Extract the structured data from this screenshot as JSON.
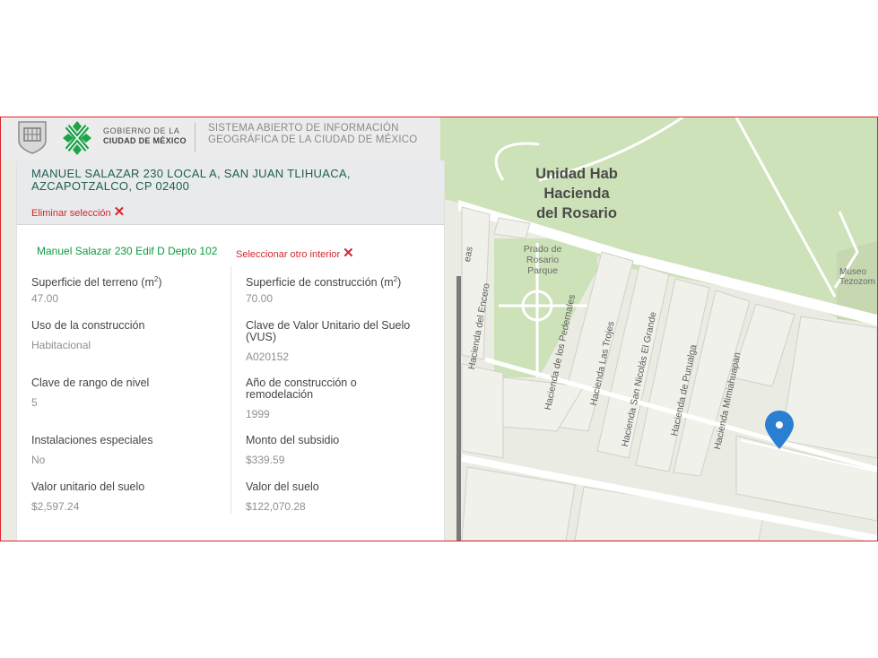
{
  "header": {
    "gov_line1": "GOBIERNO DE LA",
    "gov_line2": "CIUDAD DE MÉXICO",
    "system_line1": "SISTEMA ABIERTO DE INFORMACIÓN",
    "system_line2": "GEOGRÁFICA DE LA CIUDAD DE MÉXICO"
  },
  "selection": {
    "address_line1": "MANUEL SALAZAR 230 LOCAL A, SAN JUAN TLIHUACA,",
    "address_line2": "AZCAPOTZALCO, CP 02400",
    "delete_label": "Eliminar selección",
    "interior": "Manuel Salazar 230 Edif D Depto 102",
    "select_other_label": "Seleccionar otro interior"
  },
  "properties": {
    "terreno_label": "Superficie del terreno (m",
    "terreno_sup": "2",
    "terreno_label_end": ")",
    "terreno_value": "47.00",
    "construccion_label": "Superficie de construcción (m",
    "construccion_sup": "2",
    "construccion_label_end": ")",
    "construccion_value": "70.00",
    "uso_label": "Uso de la construcción",
    "uso_value": "Habitacional",
    "vus_label_line1": "Clave de Valor Unitario del Suelo",
    "vus_label_line2": "(VUS)",
    "vus_value": "A020152",
    "rango_label": "Clave de rango de nivel",
    "rango_value": "5",
    "anio_label_line1": "Año de construcción o",
    "anio_label_line2": "remodelación",
    "anio_value": "1999",
    "instalaciones_label": "Instalaciones especiales",
    "instalaciones_value": "No",
    "subsidio_label": "Monto del subsidio",
    "subsidio_value": "$339.59",
    "valor_unitario_label": "Valor unitario del suelo",
    "valor_unitario_value": "$2,597.24",
    "valor_suelo_label": "Valor del suelo",
    "valor_suelo_value": "$122,070.28"
  },
  "map": {
    "area_line1": "Unidad Hab",
    "area_line2": "Hacienda",
    "area_line3": "del Rosario",
    "park_line1": "Prado de",
    "park_line2": "Rosario",
    "park_line3": "Parque",
    "museum_line1": "Museo",
    "museum_line2": "Tezozom",
    "street_partial": "eas",
    "streets": [
      "Hacienda del Encero",
      "Hacienda de los Pedernales",
      "Hacienda Las Trojes",
      "Hacienda San Nicolás El Grande",
      "Hacienda de Purualga",
      "Hacienda Mimiahuapan"
    ],
    "colors": {
      "park": "#c9e0b4",
      "land": "#eceee6",
      "road": "#ffffff",
      "pin": "#2b7fd1"
    }
  },
  "colors": {
    "accent_red": "#d4262c",
    "accent_green": "#0f9a3f",
    "address_green": "#1f5e52",
    "frame_border": "#d9262c"
  }
}
